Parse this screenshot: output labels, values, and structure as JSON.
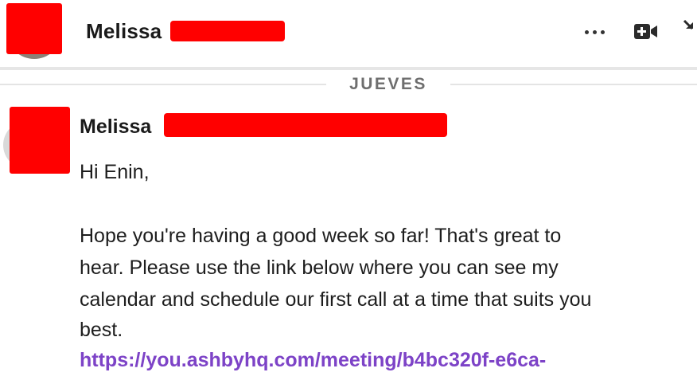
{
  "header": {
    "contact_first_name": "Melissa",
    "icons": {
      "more": "more-horizontal-icon",
      "video": "video-call-icon",
      "expand": "expand-arrow-icon"
    }
  },
  "divider": {
    "day_label": "JUEVES"
  },
  "message": {
    "sender_first_name": "Melissa",
    "lines": [
      "Hi Enin,",
      "Hope you're having a good week so far! That's great to",
      "hear. Please use the link below where you can see my",
      "calendar and schedule our first call at a time that suits you",
      "best."
    ],
    "link_text": "https://you.ashbyhq.com/meeting/b4bc320f-e6ca-"
  },
  "colors": {
    "redaction": "#ff0000",
    "link": "#7d43c7",
    "divider": "#e4e4e4"
  }
}
